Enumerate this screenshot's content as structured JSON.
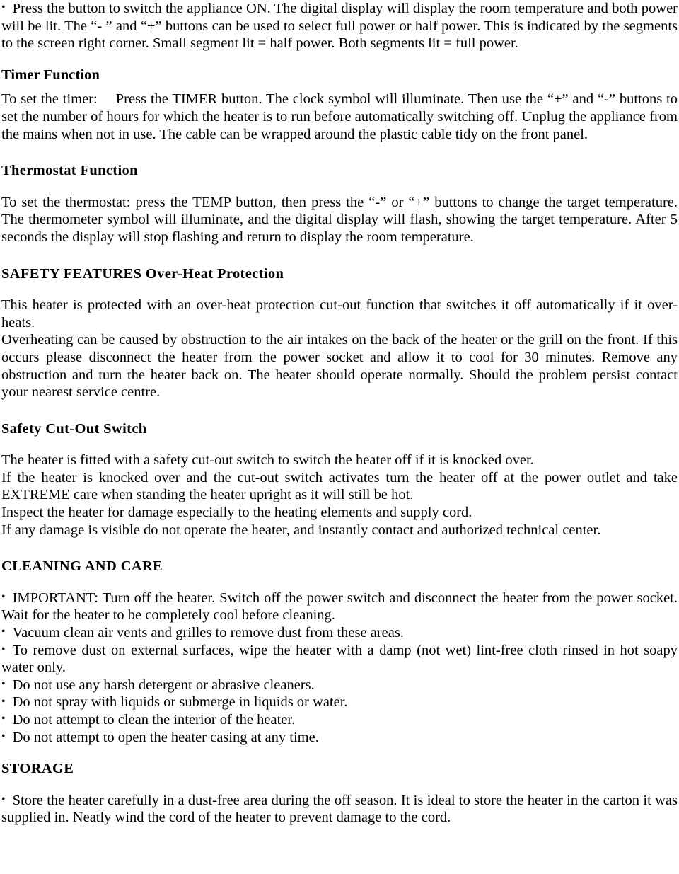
{
  "document": {
    "type": "scanned-manual-page",
    "bullet_glyph": "•"
  },
  "sections": {
    "power_bullet": {
      "text": "Press the button to switch the appliance ON. The digital display will display the room temperature and both power will be lit. The “- ” and “+” buttons can be used to select full power or half power. This is indicated by the segments to the screen right corner. Small segment lit = half power. Both segments lit = full power."
    },
    "timer": {
      "heading": "Timer Function",
      "lead": "To set the timer:",
      "body": "Press the TIMER button. The clock symbol will illuminate. Then use the “+” and “-” buttons to set the number of hours for which the heater is to run before automatically switching off. Unplug the appliance from the mains when not in use. The cable can be wrapped around the plastic cable tidy on the front panel."
    },
    "thermostat": {
      "heading": "Thermostat  Function",
      "body": "To set the thermostat: press the TEMP button, then press the “-” or “+” buttons to change the target temperature. The thermometer symbol will illuminate, and the digital display will flash, showing the target temperature. After 5 seconds the display will stop flashing and return to display the room temperature."
    },
    "safety_features": {
      "heading": "SAFETY FEATURES Over-Heat  Protection",
      "para1": "This heater is protected with an  over-heat protection cut-out function that  switches  it off automatically if it over-heats.",
      "para2": "Overheating  can be  caused by obstruction to the  air  intakes  on  the  back  of  the heater or  the  grill  on  the front. If this occurs  please disconnect the  heater from  the  power socket  and allow  it  to cool for  30  minutes. Remove  any  obstruction and  turn  the  heater  back  on.  The  heater  should   operate  normally.  Should  the problem persist  contact your nearest service  centre."
    },
    "cutout": {
      "heading": "Safety  Cut-Out Switch",
      "line1": "The heater is fitted with a safety cut-out switch to switch the heater off if it is knocked over.",
      "line2": "If  the  heater  is  knocked over  and  the cut-out  switch  activates turn  the  heater off  at  the  power outlet and take EXTREME care when  standing the heater upright  as  it will still be  hot.",
      "line3": "Inspect  the  heater for damage  especially to the  heating elements  and supply cord.",
      "line4": "If  any  damage  is  visible  do  not  operate  the  heater,  and  instantly  contact  and  authorized  technical center."
    },
    "cleaning": {
      "heading": "CLEANING AND CARE",
      "bullets": [
        "IMPORTANT: Turn  off  the  heater.  Switch off the power switch and disconnect the heater from the power socket. Wait for the heater to be  completely  cool  before cleaning.",
        "Vacuum clean air  vents and grilles to remove  dust from these  areas.",
        "To remove  dust  on  external surfaces,  wipe  the  heater with  a  damp (not wet)  lint-free  cloth  rinsed in hot soapy water only.",
        "Do not use any harsh detergent or  abrasive cleaners.",
        "Do not spray with liquids or submerge in liquids  or  water.",
        "Do not attempt  to clean the  interior of the heater.",
        "Do not attempt  to open the heater casing at  any  time."
      ]
    },
    "storage": {
      "heading": "STORAGE",
      "bullet": "Store  the  heater carefully  in  a  dust-free  area  during  the  off season.  It  is  ideal  to  store  the  heater in  the carton it was supplied in.  Neatly wind  the  cord  of the heater to prevent damage to the cord."
    }
  }
}
